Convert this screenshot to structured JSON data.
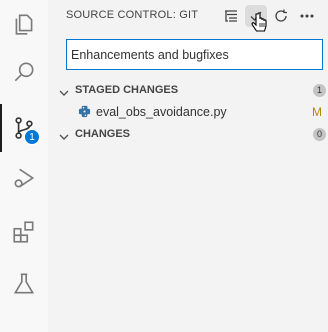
{
  "panel": {
    "title": "SOURCE CONTROL: GIT",
    "commit_message": "Enhancements and bugfixes"
  },
  "activity_bar": {
    "scm_badge": "1",
    "items": [
      "explorer-icon",
      "search-icon",
      "source-control-icon",
      "run-debug-icon",
      "extensions-icon",
      "testing-icon"
    ]
  },
  "header_actions": [
    "tree-view-icon",
    "commit-check-icon",
    "refresh-icon",
    "more-icon"
  ],
  "staged": {
    "label": "STAGED CHANGES",
    "count": "1",
    "files": [
      {
        "name": "eval_obs_avoidance.py",
        "status": "M"
      }
    ]
  },
  "changes": {
    "label": "CHANGES",
    "count": "0"
  },
  "colors": {
    "accent": "#0078d4",
    "modified": "#b58900",
    "python_icon": "#3572a5"
  }
}
